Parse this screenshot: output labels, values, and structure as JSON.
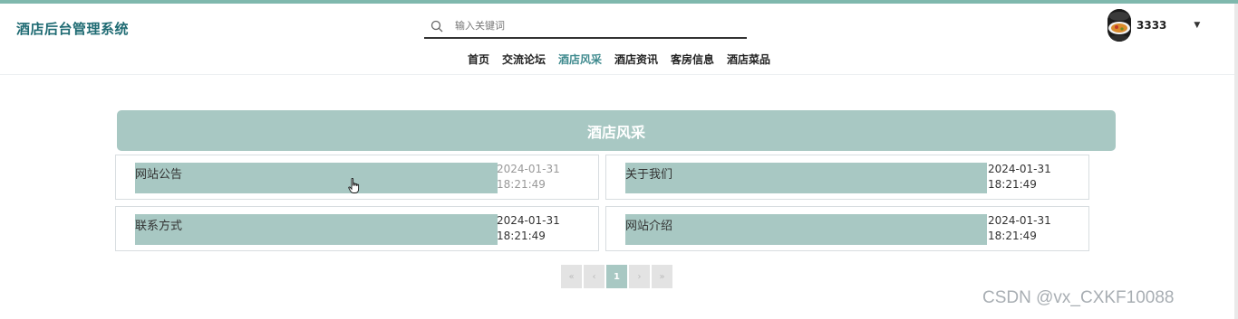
{
  "header": {
    "site_title": "酒店后台管理系统",
    "search": {
      "placeholder": "输入关键词",
      "value": ""
    },
    "user": {
      "name": "3333"
    }
  },
  "nav": {
    "items": [
      {
        "label": "首页",
        "active": false
      },
      {
        "label": "交流论坛",
        "active": false
      },
      {
        "label": "酒店风采",
        "active": true
      },
      {
        "label": "酒店资讯",
        "active": false
      },
      {
        "label": "客房信息",
        "active": false
      },
      {
        "label": "酒店菜品",
        "active": false
      }
    ]
  },
  "section": {
    "title": "酒店风采"
  },
  "cards": [
    {
      "title": "网站公告",
      "date": "2024-01-31",
      "time": "18:21:49"
    },
    {
      "title": "关于我们",
      "date": "2024-01-31",
      "time": "18:21:49"
    },
    {
      "title": "联系方式",
      "date": "2024-01-31",
      "time": "18:21:49"
    },
    {
      "title": "网站介绍",
      "date": "2024-01-31",
      "time": "18:21:49"
    }
  ],
  "pagination": {
    "first": "«",
    "prev": "‹",
    "current": "1",
    "next": "›",
    "last": "»"
  },
  "watermark": "CSDN @vx_CXKF10088",
  "colors": {
    "accent": "#a8c8c3",
    "title": "#1f6b73",
    "nav_active": "#3f8a8e"
  }
}
